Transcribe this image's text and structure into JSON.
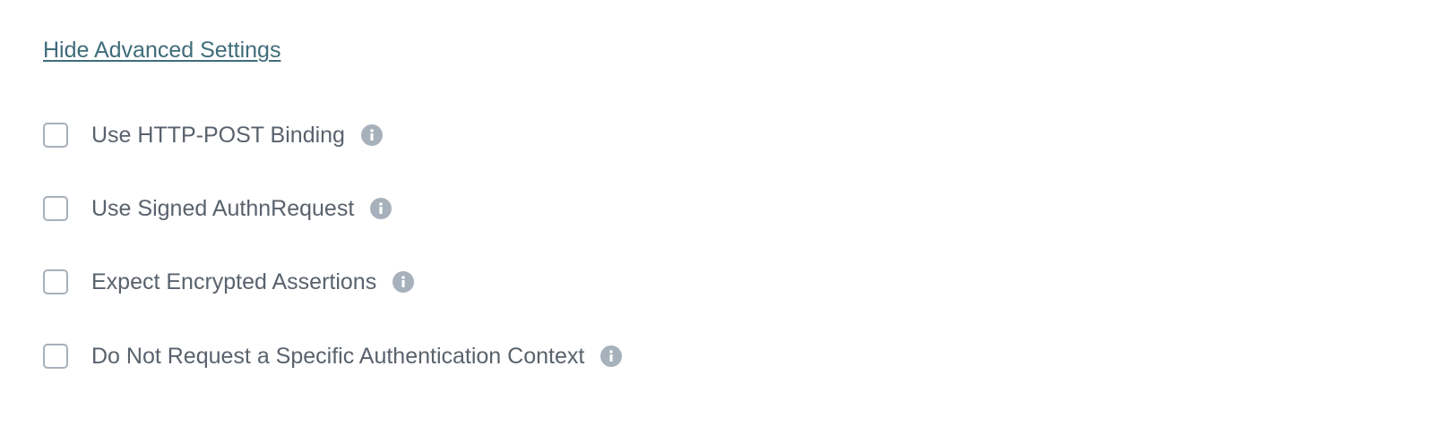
{
  "advanced": {
    "toggle_label": "Hide Advanced Settings"
  },
  "options": [
    {
      "label": "Use HTTP-POST Binding",
      "checked": false,
      "icon": "info-icon"
    },
    {
      "label": "Use Signed AuthnRequest",
      "checked": false,
      "icon": "info-icon"
    },
    {
      "label": "Expect Encrypted Assertions",
      "checked": false,
      "icon": "info-icon"
    },
    {
      "label": "Do Not Request a Specific Authentication Context",
      "checked": false,
      "icon": "info-icon"
    }
  ],
  "colors": {
    "link": "#3f6c7a",
    "label": "#59626d",
    "checkbox_border": "#a7b1bb",
    "info_icon": "#a7b1bb"
  }
}
